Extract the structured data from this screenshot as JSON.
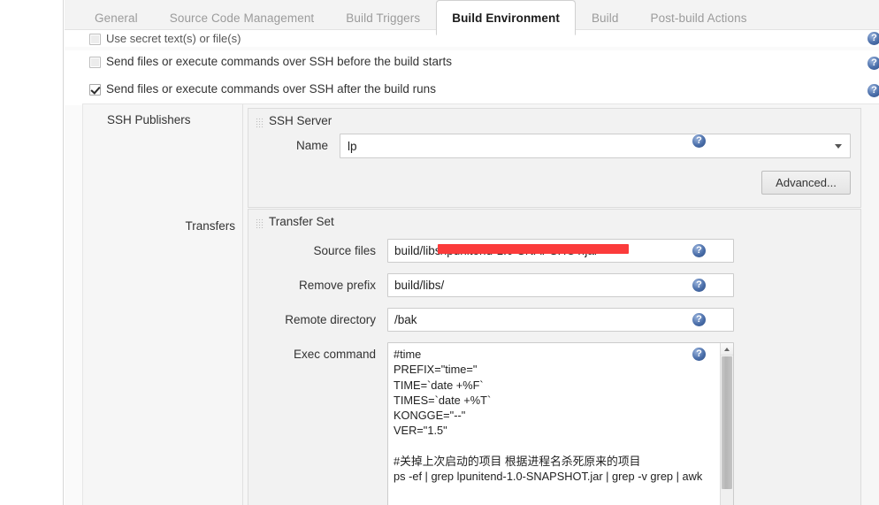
{
  "tabs": [
    {
      "label": "General",
      "active": false
    },
    {
      "label": "Source Code Management",
      "active": false
    },
    {
      "label": "Build Triggers",
      "active": false
    },
    {
      "label": "Build Environment",
      "active": true
    },
    {
      "label": "Build",
      "active": false
    },
    {
      "label": "Post-build Actions",
      "active": false
    }
  ],
  "checkboxes": {
    "clipped": {
      "label": "Use secret text(s) or file(s)",
      "checked": false
    },
    "before": {
      "label": "Send files or execute commands over SSH before the build starts",
      "checked": false
    },
    "after": {
      "label": "Send files or execute commands over SSH after the build runs",
      "checked": true
    }
  },
  "publishers": {
    "section_label": "SSH Publishers",
    "ssh_server": {
      "title": "SSH Server",
      "name_label": "Name",
      "name_value": "lp",
      "advanced_button": "Advanced..."
    },
    "transfers": {
      "label": "Transfers",
      "transfer_set_title": "Transfer Set",
      "fields": [
        {
          "label": "Source files",
          "value": "build/libs/lpunitend-1.0-SNAPSHOT.jar",
          "redacted": true
        },
        {
          "label": "Remove prefix",
          "value": "build/libs/",
          "redacted": false
        },
        {
          "label": "Remote directory",
          "value": "/bak",
          "redacted": false
        }
      ],
      "exec_label": "Exec command",
      "exec_value": "#time\nPREFIX=\"time=\"\nTIME=`date +%F`\nTIMES=`date +%T`\nKONGGE=\"--\"\nVER=\"1.5\"\n\n#关掉上次启动的项目 根据进程名杀死原来的项目\nps -ef | grep lpunitend-1.0-SNAPSHOT.jar | grep -v grep | awk"
    }
  },
  "icons": {
    "help": "help-icon",
    "grip": "drag-grip-icon",
    "caret": "chevron-down-icon",
    "scroll_up": "scroll-up-arrow-icon"
  },
  "colors": {
    "page_bg": "#fafafa",
    "panel_bg": "#f2f2f2",
    "active_tab_bg": "#ffffff",
    "tab_text": "#9b9b9b",
    "help_icon": "#3f63a0",
    "redaction": "#fb3b3b"
  }
}
